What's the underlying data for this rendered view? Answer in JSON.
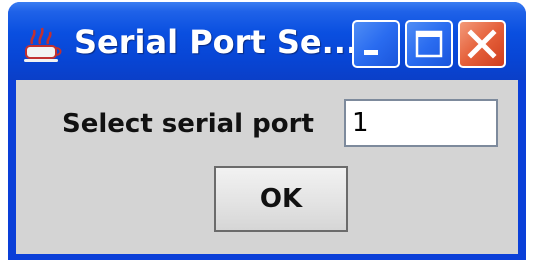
{
  "window": {
    "title": "Serial Port Se...",
    "app_icon": "java-app-icon",
    "controls": {
      "minimize_icon": "minimize-icon",
      "maximize_icon": "maximize-icon",
      "close_icon": "close-icon"
    }
  },
  "form": {
    "label": "Select serial port",
    "port_value": "1",
    "ok_label": "OK"
  },
  "colors": {
    "titlebar": "#0a4fe0",
    "client_background": "#d4d4d4",
    "close_button": "#e5603a"
  }
}
